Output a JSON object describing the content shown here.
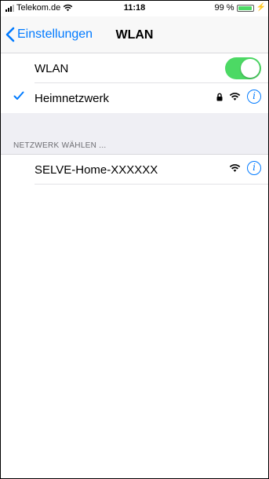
{
  "status_bar": {
    "carrier": "Telekom.de",
    "time": "11:18",
    "battery_percent": "99 %",
    "battery_level": 0.99
  },
  "nav": {
    "back_label": "Einstellungen",
    "title": "WLAN"
  },
  "wlan_toggle": {
    "label": "WLAN",
    "on": true
  },
  "connected_network": {
    "name": "Heimnetzwerk",
    "secured": true
  },
  "section": {
    "header": "NETZWERK WÄHLEN ..."
  },
  "networks": [
    {
      "name": "SELVE-Home-XXXXXX",
      "secured": false
    }
  ],
  "colors": {
    "accent": "#007aff",
    "toggle_on": "#4cd964",
    "group_bg": "#efeff4"
  }
}
